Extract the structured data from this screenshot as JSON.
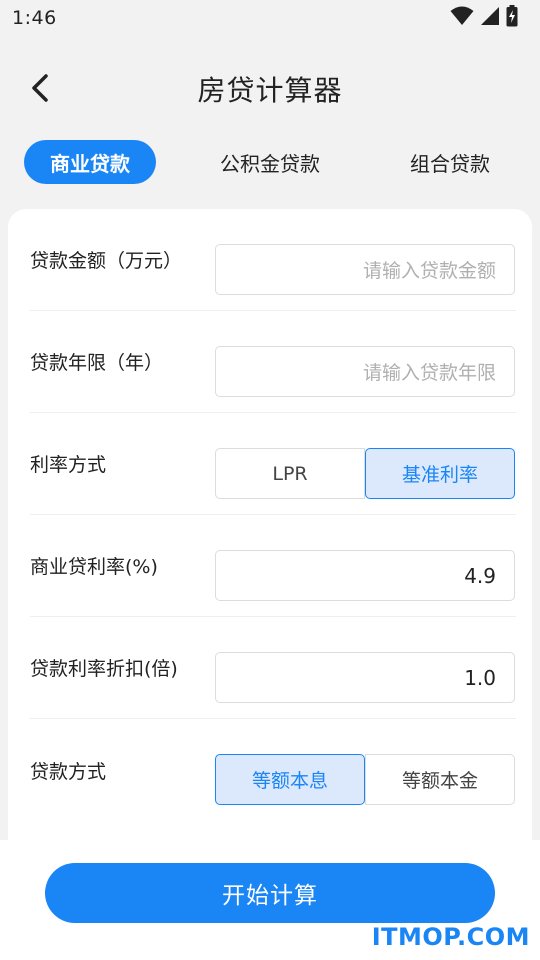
{
  "status_bar": {
    "time": "1:46"
  },
  "header": {
    "title": "房贷计算器"
  },
  "tabs": [
    {
      "label": "商业贷款",
      "active": true
    },
    {
      "label": "公积金贷款",
      "active": false
    },
    {
      "label": "组合贷款",
      "active": false
    }
  ],
  "form": {
    "amount": {
      "label": "贷款金额（万元）",
      "placeholder": "请输入贷款金额",
      "value": ""
    },
    "years": {
      "label": "贷款年限（年）",
      "placeholder": "请输入贷款年限",
      "value": ""
    },
    "rate_mode": {
      "label": "利率方式",
      "options": [
        "LPR",
        "基准利率"
      ],
      "selected": "基准利率"
    },
    "commercial_rate": {
      "label": "商业贷利率(%)",
      "value": "4.9"
    },
    "discount": {
      "label": "贷款利率折扣(倍)",
      "value": "1.0"
    },
    "repay_method": {
      "label": "贷款方式",
      "options": [
        "等额本息",
        "等额本金"
      ],
      "selected": "等额本息"
    }
  },
  "actions": {
    "calculate": "开始计算"
  },
  "watermark": "ITMOP.COM",
  "colors": {
    "accent": "#1a85f5",
    "selected_bg": "#dce9fd",
    "background": "#f2f2f2"
  },
  "icons": {
    "back": "chevron-left-icon",
    "wifi": "wifi-icon",
    "signal": "signal-icon",
    "battery": "battery-charging-icon"
  }
}
